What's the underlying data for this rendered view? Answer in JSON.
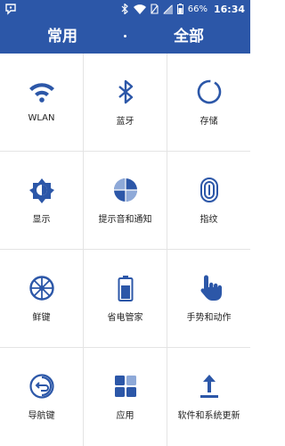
{
  "status_bar": {
    "battery": "66%",
    "time": "16:34"
  },
  "tabs": {
    "common": "常用",
    "all": "全部"
  },
  "accent_color": "#2c57a8",
  "items": [
    {
      "label": "WLAN",
      "icon": "wifi-icon"
    },
    {
      "label": "蓝牙",
      "icon": "bluetooth-icon"
    },
    {
      "label": "存储",
      "icon": "storage-icon"
    },
    {
      "label": "显示",
      "icon": "brightness-icon"
    },
    {
      "label": "提示音和通知",
      "icon": "sound-notification-icon"
    },
    {
      "label": "指纹",
      "icon": "fingerprint-icon"
    },
    {
      "label": "鲜键",
      "icon": "wheel-icon"
    },
    {
      "label": "省电管家",
      "icon": "battery-icon"
    },
    {
      "label": "手势和动作",
      "icon": "gesture-hand-icon"
    },
    {
      "label": "导航键",
      "icon": "back-navigation-icon"
    },
    {
      "label": "应用",
      "icon": "apps-grid-icon"
    },
    {
      "label": "软件和系统更新",
      "icon": "upload-update-icon"
    }
  ]
}
